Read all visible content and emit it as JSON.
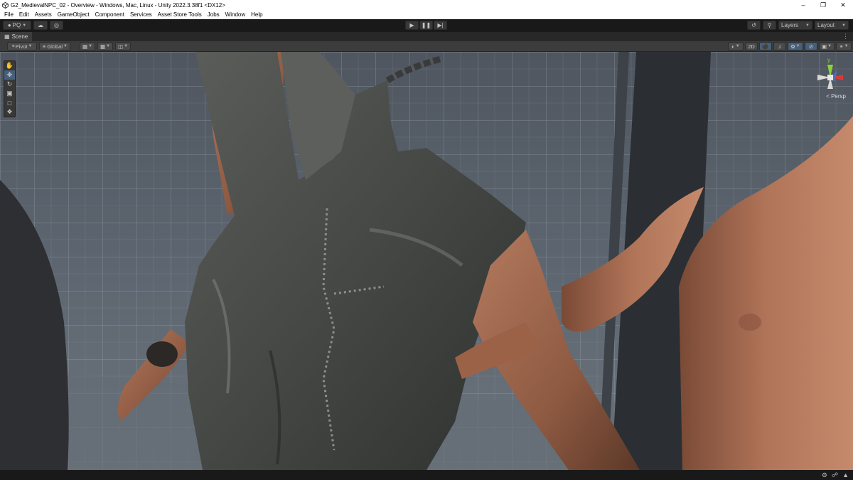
{
  "window": {
    "title": "G2_MedievalNPC_02 - Overview - Windows, Mac, Linux - Unity 2022.3.38f1 <DX12>"
  },
  "menu": [
    "File",
    "Edit",
    "Assets",
    "GameObject",
    "Component",
    "Services",
    "Asset Store Tools",
    "Jobs",
    "Window",
    "Help"
  ],
  "toolbar": {
    "account_label": "PQ",
    "layers_label": "Layers",
    "layout_label": "Layout"
  },
  "scene_tab": {
    "label": "Scene"
  },
  "scene_toolbar": {
    "pivot_label": "Pivot",
    "global_label": "Global",
    "mode_2d_label": "2D"
  },
  "gizmo": {
    "y_label": "y",
    "projection_label": "Persp"
  },
  "colors": {
    "accent_selected": "#46607c",
    "toolbar_bg": "#191919",
    "panel_bg": "#3c3c3c",
    "gizmo_x": "#d83a3a",
    "gizmo_y": "#8bd23a",
    "gizmo_z": "#3a7ad8"
  },
  "icons": {
    "toolstrip": [
      "hand-icon",
      "move-icon",
      "rotate-icon",
      "scale-icon",
      "rect-icon",
      "transform-icon"
    ],
    "status": [
      "debug-icon",
      "collab-icon",
      "bell-icon"
    ]
  }
}
